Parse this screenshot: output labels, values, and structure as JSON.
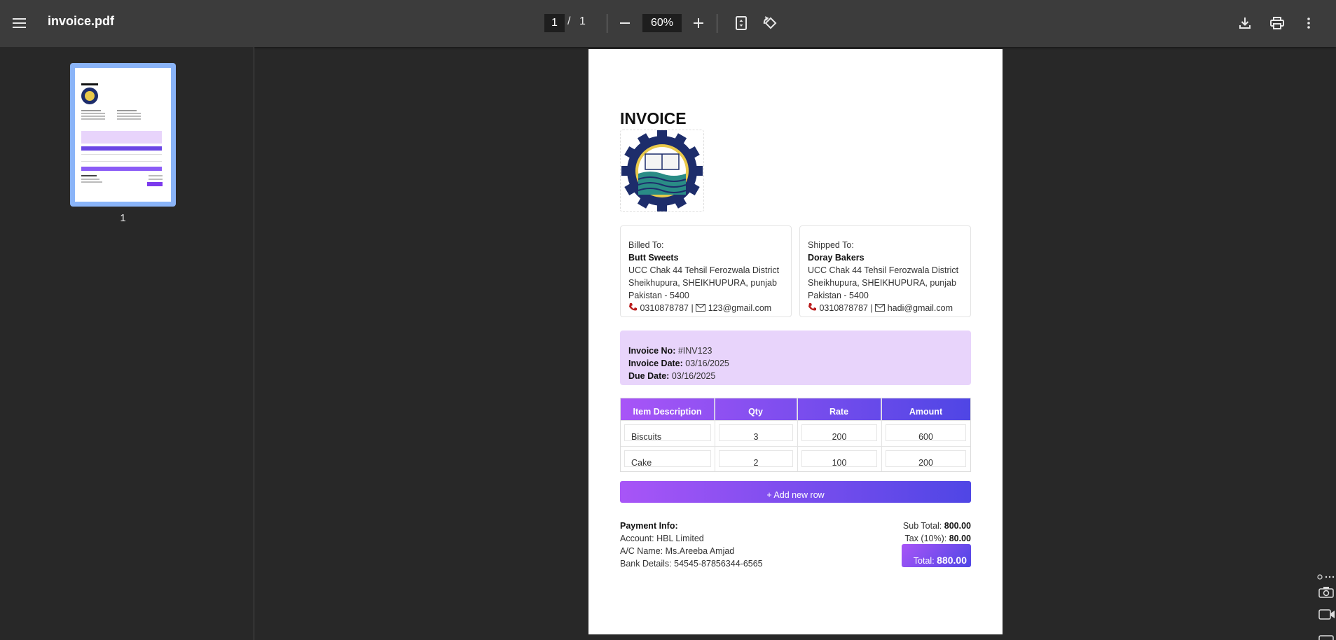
{
  "toolbar": {
    "title": "invoice.pdf",
    "current_page": "1",
    "page_separator": "/",
    "total_pages": "1",
    "zoom": "60%"
  },
  "sidebar": {
    "thumbnail_label": "1"
  },
  "invoice": {
    "heading": "INVOICE",
    "billed_to": {
      "label": "Billed To:",
      "name": "Butt Sweets",
      "address1": "UCC Chak 44 Tehsil Ferozwala District",
      "address2": "Sheikhupura, SHEIKHUPURA, punjab",
      "address3": "Pakistan - 5400",
      "phone": "0310878787",
      "separator": "|",
      "email": "123@gmail.com"
    },
    "shipped_to": {
      "label": "Shipped To:",
      "name": "Doray Bakers",
      "address1": "UCC Chak 44 Tehsil Ferozwala District",
      "address2": "Sheikhupura, SHEIKHUPURA, punjab",
      "address3": "Pakistan - 5400",
      "phone": "0310878787",
      "separator": "|",
      "email": "hadi@gmail.com"
    },
    "meta": {
      "invoice_no_label": "Invoice No:",
      "invoice_no": "#INV123",
      "invoice_date_label": "Invoice Date:",
      "invoice_date": "03/16/2025",
      "due_date_label": "Due Date:",
      "due_date": "03/16/2025"
    },
    "table": {
      "headers": [
        "Item Description",
        "Qty",
        "Rate",
        "Amount"
      ],
      "rows": [
        [
          "Biscuits",
          "3",
          "200",
          "600"
        ],
        [
          "Cake",
          "2",
          "100",
          "200"
        ]
      ]
    },
    "add_row_label": "+ Add new row",
    "payment": {
      "label": "Payment Info:",
      "account": "Account: HBL Limited",
      "ac_name": "A/C Name: Ms.Areeba Amjad",
      "bank_details": "Bank Details: 54545-87856344-6565"
    },
    "totals": {
      "subtotal_label": "Sub Total:",
      "subtotal": "800.00",
      "tax_label": "Tax (10%):",
      "tax": "80.00",
      "total_label": "Total:",
      "total": "880.00"
    }
  },
  "colors": {
    "toolbar_bg": "#3c3c3c",
    "viewer_bg": "#282828",
    "accent_start": "#a855f7",
    "accent_end": "#4f46e5",
    "info_bg": "#e8d4fb",
    "thumb_highlight": "#8ab4f8"
  }
}
